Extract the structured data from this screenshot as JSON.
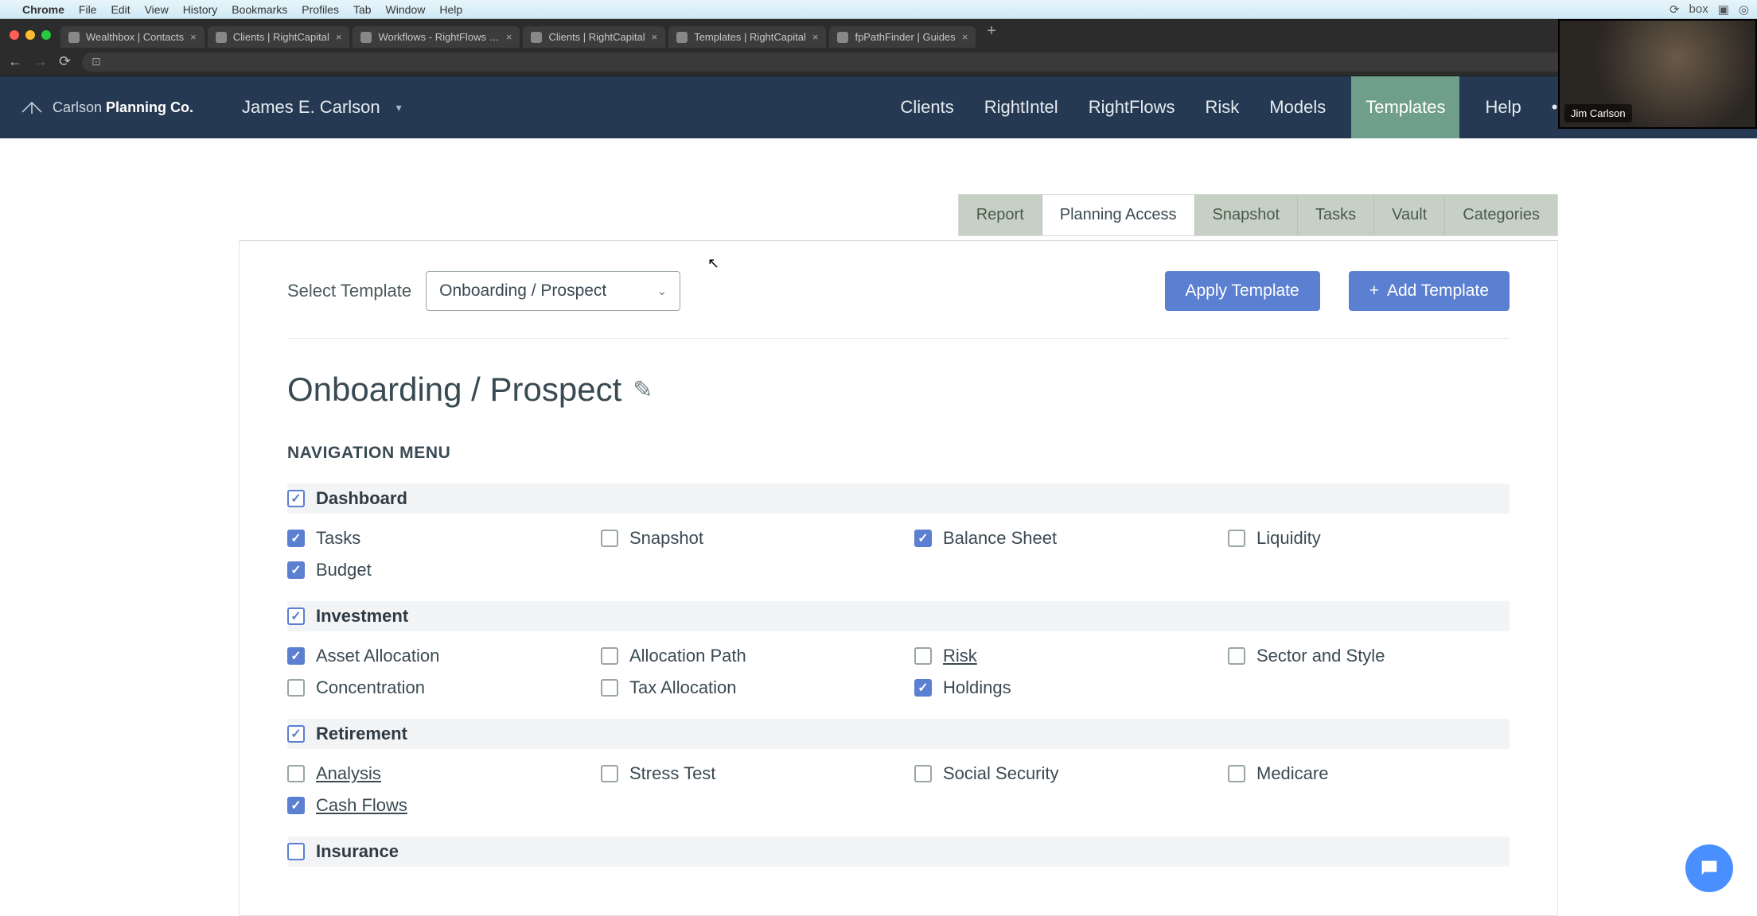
{
  "macos_menu": {
    "app": "Chrome",
    "items": [
      "File",
      "Edit",
      "View",
      "History",
      "Bookmarks",
      "Profiles",
      "Tab",
      "Window",
      "Help"
    ]
  },
  "browser_tabs": [
    {
      "title": "Wealthbox | Contacts"
    },
    {
      "title": "Clients | RightCapital"
    },
    {
      "title": "Workflows - RightFlows | Rig"
    },
    {
      "title": "Clients | RightCapital"
    },
    {
      "title": "Templates | RightCapital"
    },
    {
      "title": "fpPathFinder | Guides"
    }
  ],
  "brand": {
    "name_light": "Carlson",
    "name_bold": "Planning Co."
  },
  "user": {
    "name": "James E. Carlson"
  },
  "nav": [
    {
      "label": "Clients",
      "active": false
    },
    {
      "label": "RightIntel",
      "active": false
    },
    {
      "label": "RightFlows",
      "active": false
    },
    {
      "label": "Risk",
      "active": false
    },
    {
      "label": "Models",
      "active": false
    },
    {
      "label": "Templates",
      "active": true
    },
    {
      "label": "Help",
      "active": false
    }
  ],
  "page_tabs": [
    {
      "label": "Report",
      "active": false
    },
    {
      "label": "Planning Access",
      "active": true
    },
    {
      "label": "Snapshot",
      "active": false
    },
    {
      "label": "Tasks",
      "active": false
    },
    {
      "label": "Vault",
      "active": false
    },
    {
      "label": "Categories",
      "active": false
    }
  ],
  "select_template": {
    "label": "Select Template",
    "value": "Onboarding / Prospect"
  },
  "buttons": {
    "apply": "Apply Template",
    "add": "Add Template"
  },
  "template": {
    "name": "Onboarding / Prospect"
  },
  "section_heading": "NAVIGATION MENU",
  "groups": [
    {
      "name": "Dashboard",
      "checked": true,
      "items": [
        {
          "name": "Tasks",
          "checked": true
        },
        {
          "name": "Snapshot",
          "checked": false
        },
        {
          "name": "Balance Sheet",
          "checked": true
        },
        {
          "name": "Liquidity",
          "checked": false
        },
        {
          "name": "Budget",
          "checked": true
        }
      ]
    },
    {
      "name": "Investment",
      "checked": true,
      "items": [
        {
          "name": "Asset Allocation",
          "checked": true
        },
        {
          "name": "Allocation Path",
          "checked": false
        },
        {
          "name": "Risk",
          "checked": false,
          "underline": true
        },
        {
          "name": "Sector and Style",
          "checked": false
        },
        {
          "name": "Concentration",
          "checked": false
        },
        {
          "name": "Tax Allocation",
          "checked": false
        },
        {
          "name": "Holdings",
          "checked": true
        }
      ]
    },
    {
      "name": "Retirement",
      "checked": true,
      "items": [
        {
          "name": "Analysis",
          "checked": false,
          "underline": true
        },
        {
          "name": "Stress Test",
          "checked": false
        },
        {
          "name": "Social Security",
          "checked": false
        },
        {
          "name": "Medicare",
          "checked": false
        },
        {
          "name": "Cash Flows",
          "checked": true,
          "underline": true
        }
      ]
    },
    {
      "name": "Insurance",
      "checked": false,
      "items": []
    }
  ],
  "video": {
    "name": "Jim Carlson"
  }
}
